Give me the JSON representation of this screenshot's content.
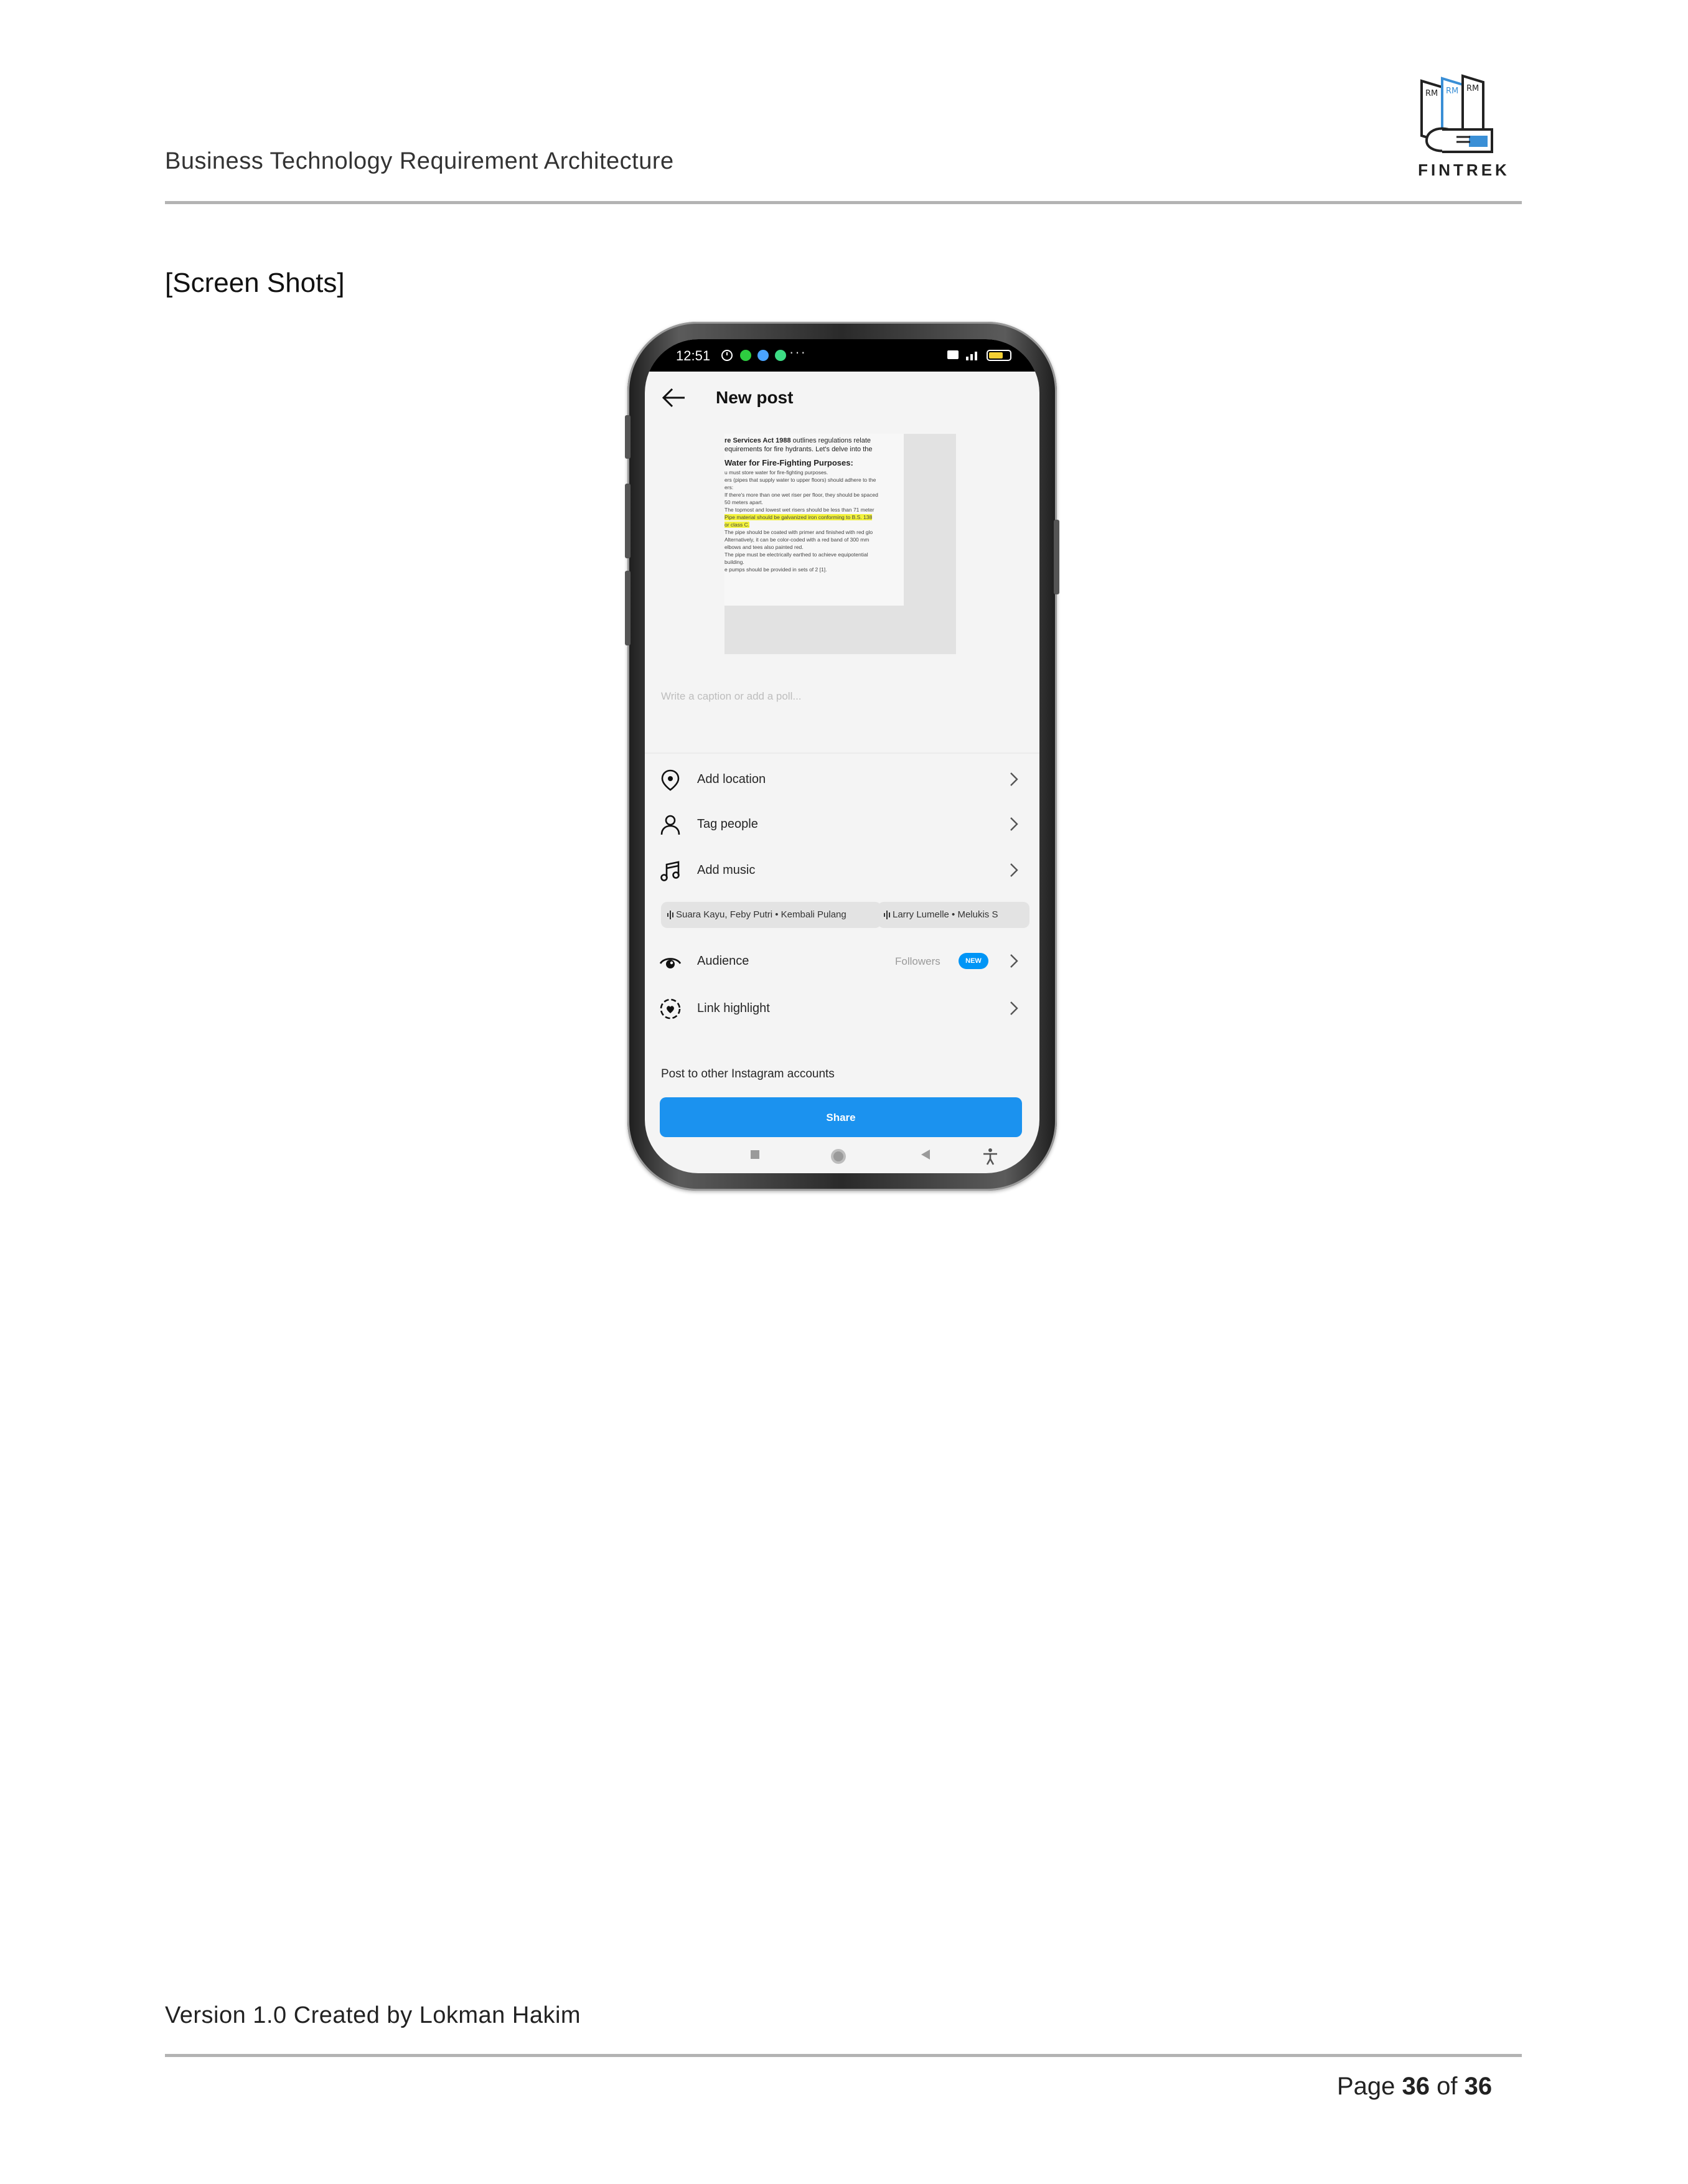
{
  "document": {
    "header_title": "Business Technology Requirement Architecture",
    "logo_text": "FINTREK",
    "logo_initials": [
      "RM",
      "RM",
      "RM"
    ],
    "section_heading": "[Screen Shots]",
    "footer_version": "Version 1.0 Created by Lokman Hakim",
    "page": {
      "prefix": "Page",
      "current": "36",
      "middle": "of",
      "total": "36"
    }
  },
  "phone": {
    "status_bar": {
      "time": "12:51",
      "more": "···"
    },
    "appbar": {
      "title": "New post",
      "back_icon": "arrow-left-icon"
    },
    "preview_text": {
      "line1": "re Services Act 1988 outlines regulations relate",
      "line2": "equirements for fire hydrants. Let's delve into the",
      "heading": "Water for Fire-Fighting Purposes:",
      "lines": [
        "u must store water for fire-fighting purposes.",
        "ers (pipes that supply water to upper floors) should adhere to the",
        "ers:",
        "If there's more than one wet riser per floor, they should be spaced",
        "50 meters apart.",
        "The topmost and lowest wet risers should be less than 71 meter",
        "Pipe material should be galvanized iron conforming to B.S. 138",
        "or class C.",
        "The pipe should be coated with primer and finished with red glo",
        "Alternatively, it can be color-coded with a red band of 300 mm",
        "elbows and tees also painted red.",
        "The pipe must be electrically earthed to achieve equipotential",
        "building.",
        "e pumps should be provided in sets of 2 [1]."
      ]
    },
    "caption_placeholder": "Write a caption or add a poll...",
    "rows": {
      "location": {
        "label": "Add location",
        "icon": "location-pin-icon"
      },
      "tag": {
        "label": "Tag people",
        "icon": "person-icon"
      },
      "music": {
        "label": "Add music",
        "icon": "music-note-icon"
      },
      "audience": {
        "label": "Audience",
        "value": "Followers",
        "badge": "NEW",
        "icon": "eye-icon"
      },
      "link": {
        "label": "Link highlight",
        "icon": "link-highlight-icon"
      }
    },
    "music_suggestions": [
      "Suara Kayu, Feby Putri • Kembali Pulang",
      "Larry Lumelle • Melukis S"
    ],
    "post_other_accounts": "Post to other Instagram accounts",
    "share_label": "Share",
    "nav_buttons": [
      "recent-apps-icon",
      "home-icon",
      "back-triangle-icon",
      "accessibility-icon"
    ]
  }
}
